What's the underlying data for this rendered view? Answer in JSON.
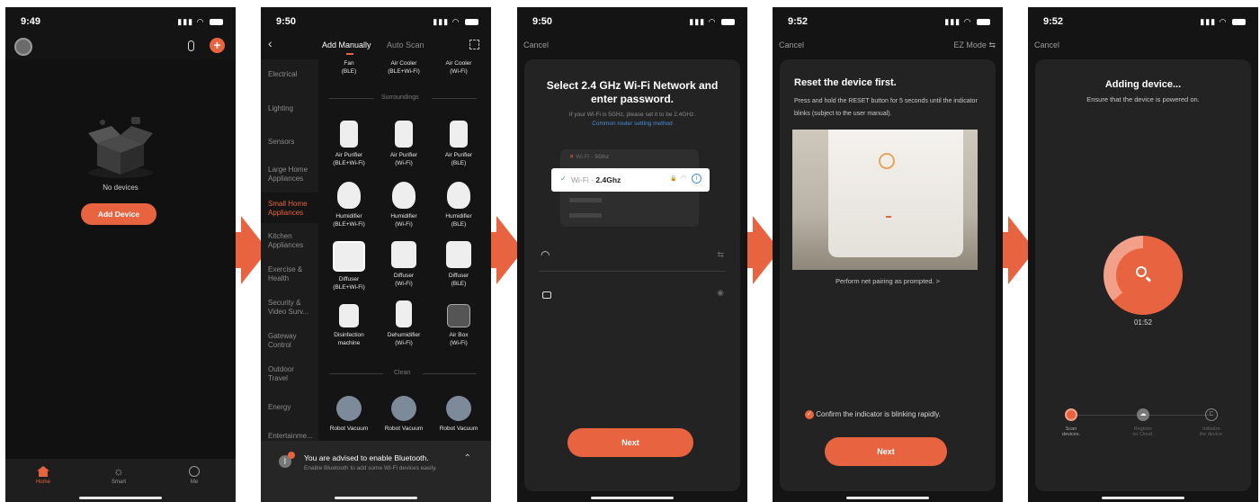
{
  "phone1": {
    "time": "9:49",
    "no_devices": "No devices",
    "add_device": "Add Device",
    "nav": [
      "Home",
      "Smart",
      "Me"
    ]
  },
  "phone2": {
    "time": "9:50",
    "tab_manual": "Add Manually",
    "tab_auto": "Auto Scan",
    "categories": [
      "Electrical",
      "Lighting",
      "Sensors",
      "Large Home Appliances",
      "Small Home Appliances",
      "Kitchen Appliances",
      "Exercise & Health",
      "Security & Video Surv...",
      "Gateway Control",
      "Outdoor Travel",
      "Energy",
      "Entertainme..."
    ],
    "top_row": [
      {
        "name": "Fan",
        "type": "(BLE)"
      },
      {
        "name": "Air Cooler",
        "type": "(BLE+Wi-Fi)"
      },
      {
        "name": "Air Cooler",
        "type": "(Wi-Fi)"
      }
    ],
    "section_surroundings": "Surroundings",
    "section_clean": "Clean",
    "devices": [
      {
        "name": "Air Purifier",
        "type": "(BLE+Wi-Fi)"
      },
      {
        "name": "Air Purifier",
        "type": "(Wi-Fi)"
      },
      {
        "name": "Air Purifier",
        "type": "(BLE)"
      },
      {
        "name": "Humidifier",
        "type": "(BLE+Wi-Fi)"
      },
      {
        "name": "Humidifier",
        "type": "(Wi-Fi)"
      },
      {
        "name": "Humidifier",
        "type": "(BLE)"
      },
      {
        "name": "Diffuser",
        "type": "(BLE+Wi-Fi)"
      },
      {
        "name": "Diffuser",
        "type": "(Wi-Fi)"
      },
      {
        "name": "Diffuser",
        "type": "(BLE)"
      },
      {
        "name": "Disinfection",
        "type": "machine"
      },
      {
        "name": "Dehumidifier",
        "type": "(Wi-Fi)"
      },
      {
        "name": "Air Box",
        "type": "(Wi-Fi)"
      }
    ],
    "robots": [
      "Robot Vacuum",
      "Robot Vacuum",
      "Robot Vacuum"
    ],
    "bt_title": "You are advised to enable Bluetooth.",
    "bt_sub": "Enable Bluetooth to add some Wi-Fi devices easily."
  },
  "phone3": {
    "time": "9:50",
    "cancel": "Cancel",
    "title": "Select 2.4 GHz Wi-Fi Network and enter password.",
    "hint": "If your Wi-Fi is 5GHz, please set it to be 2.4GHz.",
    "link": "Common router setting method",
    "wifi_5g_prefix": "Wi-Fi - ",
    "wifi_5g_band": "5Ghz",
    "wifi_24_prefix": "Wi-Fi - ",
    "wifi_24_band": "2.4Ghz",
    "next": "Next"
  },
  "phone4": {
    "time": "9:52",
    "cancel": "Cancel",
    "mode": "EZ Mode",
    "title": "Reset the device first.",
    "desc": "Press and hold the RESET button for 5 seconds until the indicator blinks (subject to the user manual).",
    "perform": "Perform net pairing as prompted. >",
    "confirm": "Confirm the indicator is blinking rapidly.",
    "next": "Next"
  },
  "phone5": {
    "time": "9:52",
    "cancel": "Cancel",
    "title": "Adding device...",
    "subtitle": "Ensure that the device is powered on.",
    "timer": "01:52",
    "steps": [
      {
        "l1": "Scan",
        "l2": "devices."
      },
      {
        "l1": "Register",
        "l2": "on Cloud."
      },
      {
        "l1": "Initialize",
        "l2": "the device."
      }
    ]
  },
  "colors": {
    "accent": "#e8633f",
    "background": "#141414",
    "card": "#232323",
    "link": "#4a8fd8"
  }
}
